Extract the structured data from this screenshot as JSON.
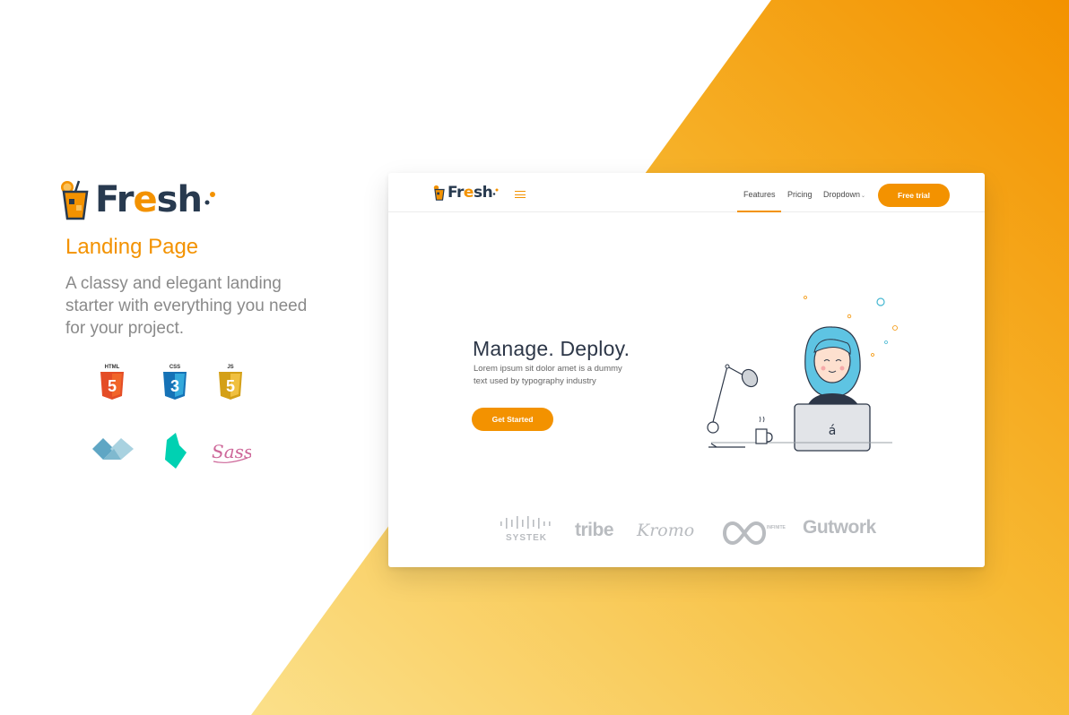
{
  "colors": {
    "accent": "#f39200",
    "dark": "#283a4f",
    "gradient_start": "#fbe08a",
    "gradient_end": "#f39200",
    "muted": "#8a8a8a"
  },
  "promo": {
    "brand": {
      "name_pre": "Fr",
      "name_e": "e",
      "name_post": "sh"
    },
    "subtitle": "Landing Page",
    "description": "A classy and elegant landing starter with everything you need for your project.",
    "tech_badges": [
      {
        "icon": "html5-icon",
        "label": "HTML"
      },
      {
        "icon": "css3-icon",
        "label": "CSS"
      },
      {
        "icon": "js-icon",
        "label": "JS"
      },
      {
        "icon": "vuetify-icon",
        "label": ""
      },
      {
        "icon": "bulma-icon",
        "label": ""
      },
      {
        "icon": "sass-icon",
        "label": "Sass"
      }
    ]
  },
  "mock": {
    "brand": {
      "name_pre": "Fr",
      "name_e": "e",
      "name_post": "sh"
    },
    "nav": {
      "features": "Features",
      "pricing": "Pricing",
      "dropdown": "Dropdown",
      "cta": "Free trial"
    },
    "hero": {
      "title": "Manage. Deploy.",
      "text": "Lorem ipsum sit dolor amet is a dummy text used by typography industry",
      "button": "Get Started"
    },
    "clients": {
      "systek": "SYSTEK",
      "tribe": "tribe",
      "kromo": "Kromo",
      "infinite": "INFINITE",
      "gutwork": "Gutwork"
    }
  }
}
